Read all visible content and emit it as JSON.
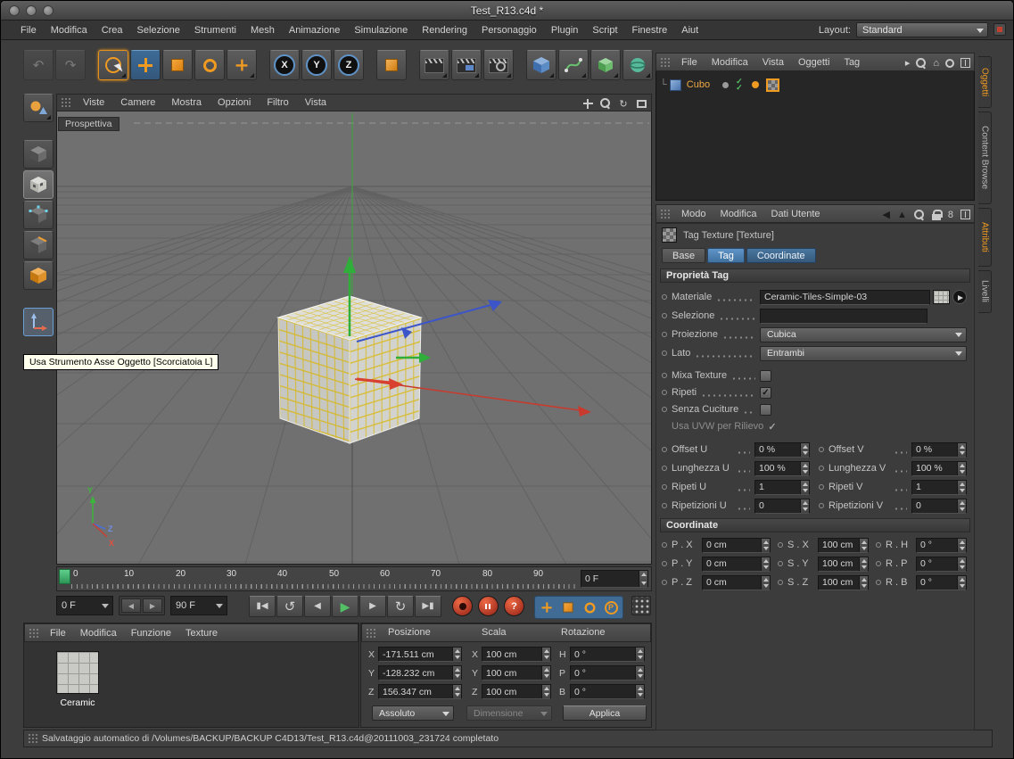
{
  "window": {
    "title": "Test_R13.c4d *"
  },
  "menubar": {
    "items": [
      "File",
      "Modifica",
      "Crea",
      "Selezione",
      "Strumenti",
      "Mesh",
      "Animazione",
      "Simulazione",
      "Rendering",
      "Personaggio",
      "Plugin",
      "Script",
      "Finestre",
      "Aiut"
    ],
    "layout_label": "Layout:",
    "layout_value": "Standard"
  },
  "icons": {
    "undo": "↶",
    "redo": "↷",
    "tri_right": "▸",
    "tri_left": "◀",
    "tri_up": "▲",
    "play": "▶",
    "prev": "◀",
    "next": "▶",
    "loop_back": "↺",
    "loop_fwd": "↻",
    "bar_start": "▮◀",
    "bar_end": "▶▮",
    "question": "?",
    "check": "✓",
    "tree_branch": "└",
    "home": "⌂",
    "link8": "8",
    "letter_p": "P",
    "axis_x": "X",
    "axis_y": "Y",
    "axis_z": "Z"
  },
  "viewport": {
    "menu": [
      "Viste",
      "Camere",
      "Mostra",
      "Opzioni",
      "Filtro",
      "Vista"
    ],
    "camera_label": "Prospettiva",
    "gizmo": {
      "x": "X",
      "y": "Y",
      "z": "Z"
    }
  },
  "tooltip": "Usa Strumento Asse Oggetto [Scorciatoia L]",
  "timeline": {
    "ticks": [
      "0",
      "10",
      "20",
      "30",
      "40",
      "50",
      "60",
      "70",
      "80",
      "90"
    ],
    "frame_field": "0 F"
  },
  "transport": {
    "start": "0 F",
    "end": "90 F"
  },
  "materials": {
    "menu": [
      "File",
      "Modifica",
      "Funzione",
      "Texture"
    ],
    "items": [
      {
        "name": "Ceramic"
      }
    ]
  },
  "coords": {
    "headers": [
      "Posizione",
      "Scala",
      "Rotazione"
    ],
    "rows": [
      {
        "l1": "X",
        "v1": "-171.511 cm",
        "l2": "X",
        "v2": "100 cm",
        "l3": "H",
        "v3": "0 °"
      },
      {
        "l1": "Y",
        "v1": "-128.232 cm",
        "l2": "Y",
        "v2": "100 cm",
        "l3": "P",
        "v3": "0 °"
      },
      {
        "l1": "Z",
        "v1": "156.347 cm",
        "l2": "Z",
        "v2": "100 cm",
        "l3": "B",
        "v3": "0 °"
      }
    ],
    "mode": "Assoluto",
    "dimension": "Dimensione",
    "apply": "Applica"
  },
  "statusbar": "Salvataggio automatico di /Volumes/BACKUP/BACKUP C4D13/Test_R13.c4d@20111003_231724 completato",
  "object_manager": {
    "menu": [
      "File",
      "Modifica",
      "Vista",
      "Oggetti",
      "Tag"
    ],
    "object_name": "Cubo"
  },
  "side_tabs": [
    "Oggetti",
    "Content Browse",
    "Attributi",
    "Livelli"
  ],
  "attributes": {
    "menu": [
      "Modo",
      "Modifica",
      "Dati Utente"
    ],
    "title": "Tag Texture [Texture]",
    "tabs": [
      "Base",
      "Tag",
      "Coordinate"
    ],
    "section_tag": "Proprietà Tag",
    "materiale": {
      "label": "Materiale",
      "value": "Ceramic-Tiles-Simple-03"
    },
    "selezione": {
      "label": "Selezione",
      "value": ""
    },
    "proiezione": {
      "label": "Proiezione",
      "value": "Cubica"
    },
    "lato": {
      "label": "Lato",
      "value": "Entrambi"
    },
    "mixa": {
      "label": "Mixa Texture",
      "checked": false
    },
    "ripeti": {
      "label": "Ripeti",
      "checked": true
    },
    "cuciture": {
      "label": "Senza Cuciture",
      "checked": false
    },
    "uvw": {
      "label": "Usa UVW per Rilievo",
      "checked": true
    },
    "uv_rows": [
      {
        "l1": "Offset U",
        "v1": "0 %",
        "l2": "Offset V",
        "v2": "0 %"
      },
      {
        "l1": "Lunghezza U",
        "v1": "100 %",
        "l2": "Lunghezza V",
        "v2": "100 %"
      },
      {
        "l1": "Ripeti U",
        "v1": "1",
        "l2": "Ripeti V",
        "v2": "1"
      },
      {
        "l1": "Ripetizioni U",
        "v1": "0",
        "l2": "Ripetizioni V",
        "v2": "0"
      }
    ],
    "section_coord": "Coordinate",
    "coord_rows": [
      {
        "l1": "P . X",
        "v1": "0 cm",
        "l2": "S . X",
        "v2": "100 cm",
        "l3": "R . H",
        "v3": "0 °"
      },
      {
        "l1": "P . Y",
        "v1": "0 cm",
        "l2": "S . Y",
        "v2": "100 cm",
        "l3": "R . P",
        "v3": "0 °"
      },
      {
        "l1": "P . Z",
        "v1": "0 cm",
        "l2": "S . Z",
        "v2": "100 cm",
        "l3": "R . B",
        "v3": "0 °"
      }
    ]
  }
}
